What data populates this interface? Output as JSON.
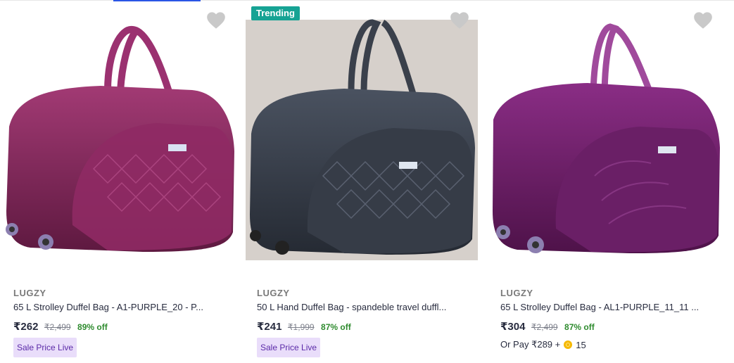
{
  "products": [
    {
      "brand": "LUGZY",
      "title": "65 L Strolley Duffel Bag - A1-PURPLE_20 - P...",
      "price": "₹262",
      "mrp": "₹2,499",
      "discount": "89% off",
      "tag": "Sale Price Live",
      "bag_color": "#8a2a5e"
    },
    {
      "badge": "Trending",
      "brand": "LUGZY",
      "title": "50 L Hand Duffel Bag - spandeble travel duffl...",
      "price": "₹241",
      "mrp": "₹1,999",
      "discount": "87% off",
      "tag": "Sale Price Live",
      "bag_color": "#3c4350"
    },
    {
      "brand": "LUGZY",
      "title": "65 L Strolley Duffel Bag - AL1-PURPLE_11_11 ...",
      "price": "₹304",
      "mrp": "₹2,499",
      "discount": "87% off",
      "or_pay_text": "Or Pay ₹289 +",
      "coins": "15",
      "bag_color": "#6a1f66"
    }
  ],
  "icons": {
    "wishlist": "heart-icon",
    "coin": "supercoin-icon"
  },
  "colors": {
    "discount": "#2e8b2e",
    "trending_badge": "#16a394",
    "sale_tag_bg": "#e9ddfa"
  }
}
